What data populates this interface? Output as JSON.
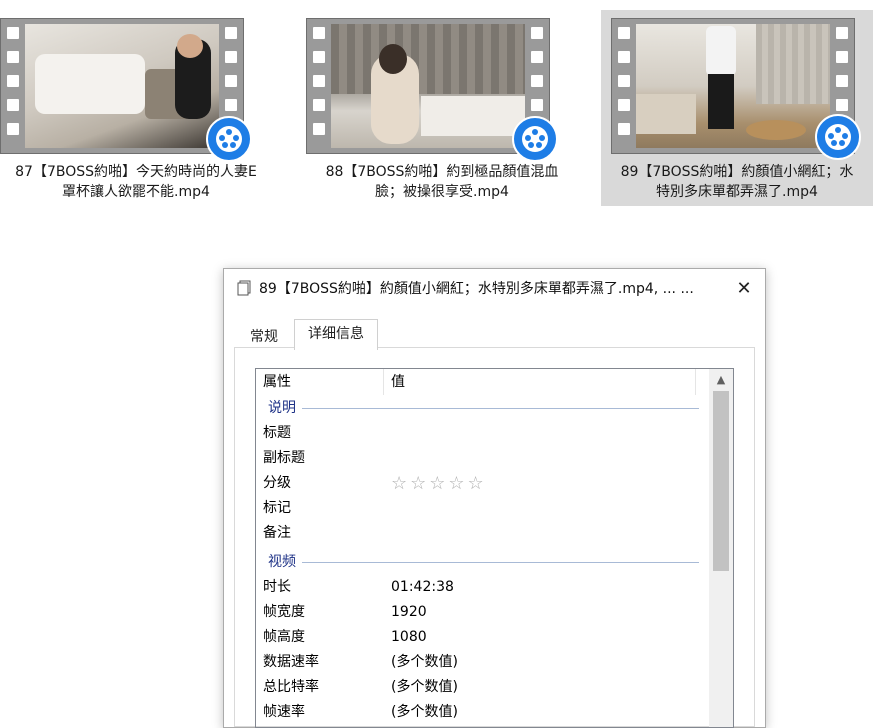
{
  "thumbnails": [
    {
      "label_line1": "87【7BOSS約啪】今天約時尚的人妻E",
      "label_line2": "罩杯讓人欲罷不能.mp4",
      "selected": false
    },
    {
      "label_line1": "88【7BOSS約啪】約到極品顏值混血",
      "label_line2": "臉；被操很享受.mp4",
      "selected": false
    },
    {
      "label_line1": "89【7BOSS約啪】約顏值小網紅；水",
      "label_line2": "特別多床單都弄濕了.mp4",
      "selected": true
    }
  ],
  "dialog": {
    "title": "89【7BOSS約啪】約顏值小網紅；水特別多床單都弄濕了.mp4, ... ...",
    "close_icon": "✕",
    "tabs": {
      "general": "常规",
      "details": "详细信息"
    },
    "header": {
      "property": "属性",
      "value": "值"
    },
    "groups": {
      "description": {
        "label": "说明",
        "rows": [
          {
            "key": "标题",
            "value": ""
          },
          {
            "key": "副标题",
            "value": ""
          },
          {
            "key": "分级",
            "value": ""
          },
          {
            "key": "标记",
            "value": ""
          },
          {
            "key": "备注",
            "value": ""
          }
        ],
        "rating_stars": "☆☆☆☆☆",
        "rating_value": 0
      },
      "video": {
        "label": "视频",
        "rows": [
          {
            "key": "时长",
            "value": "01:42:38"
          },
          {
            "key": "帧宽度",
            "value": "1920"
          },
          {
            "key": "帧高度",
            "value": "1080"
          },
          {
            "key": "数据速率",
            "value": "(多个数值)"
          },
          {
            "key": "总比特率",
            "value": "(多个数值)"
          },
          {
            "key": "帧速率",
            "value": "(多个数值)"
          }
        ]
      }
    }
  },
  "colors": {
    "selection": "#d9d9d9",
    "group_label": "#1e3287",
    "player_badge": "#1e7de6"
  }
}
